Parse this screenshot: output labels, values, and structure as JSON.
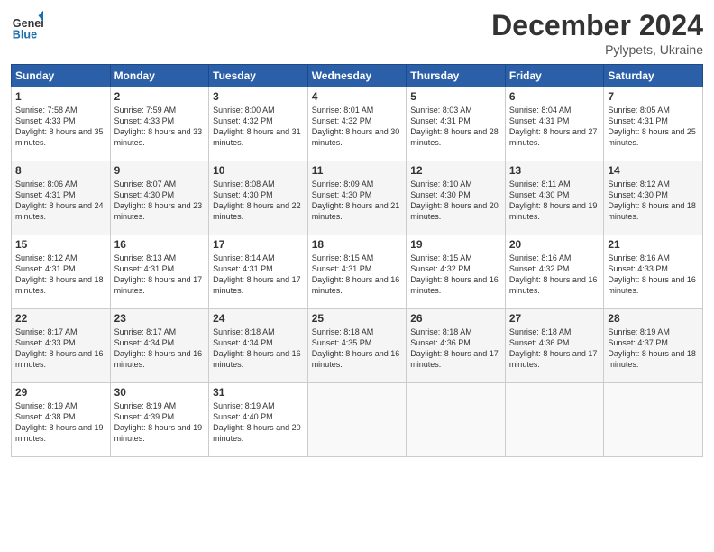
{
  "header": {
    "logo_general": "General",
    "logo_blue": "Blue",
    "month_year": "December 2024",
    "location": "Pylypets, Ukraine"
  },
  "days_of_week": [
    "Sunday",
    "Monday",
    "Tuesday",
    "Wednesday",
    "Thursday",
    "Friday",
    "Saturday"
  ],
  "weeks": [
    [
      {
        "day": "1",
        "sunrise": "Sunrise: 7:58 AM",
        "sunset": "Sunset: 4:33 PM",
        "daylight": "Daylight: 8 hours and 35 minutes."
      },
      {
        "day": "2",
        "sunrise": "Sunrise: 7:59 AM",
        "sunset": "Sunset: 4:33 PM",
        "daylight": "Daylight: 8 hours and 33 minutes."
      },
      {
        "day": "3",
        "sunrise": "Sunrise: 8:00 AM",
        "sunset": "Sunset: 4:32 PM",
        "daylight": "Daylight: 8 hours and 31 minutes."
      },
      {
        "day": "4",
        "sunrise": "Sunrise: 8:01 AM",
        "sunset": "Sunset: 4:32 PM",
        "daylight": "Daylight: 8 hours and 30 minutes."
      },
      {
        "day": "5",
        "sunrise": "Sunrise: 8:03 AM",
        "sunset": "Sunset: 4:31 PM",
        "daylight": "Daylight: 8 hours and 28 minutes."
      },
      {
        "day": "6",
        "sunrise": "Sunrise: 8:04 AM",
        "sunset": "Sunset: 4:31 PM",
        "daylight": "Daylight: 8 hours and 27 minutes."
      },
      {
        "day": "7",
        "sunrise": "Sunrise: 8:05 AM",
        "sunset": "Sunset: 4:31 PM",
        "daylight": "Daylight: 8 hours and 25 minutes."
      }
    ],
    [
      {
        "day": "8",
        "sunrise": "Sunrise: 8:06 AM",
        "sunset": "Sunset: 4:31 PM",
        "daylight": "Daylight: 8 hours and 24 minutes."
      },
      {
        "day": "9",
        "sunrise": "Sunrise: 8:07 AM",
        "sunset": "Sunset: 4:30 PM",
        "daylight": "Daylight: 8 hours and 23 minutes."
      },
      {
        "day": "10",
        "sunrise": "Sunrise: 8:08 AM",
        "sunset": "Sunset: 4:30 PM",
        "daylight": "Daylight: 8 hours and 22 minutes."
      },
      {
        "day": "11",
        "sunrise": "Sunrise: 8:09 AM",
        "sunset": "Sunset: 4:30 PM",
        "daylight": "Daylight: 8 hours and 21 minutes."
      },
      {
        "day": "12",
        "sunrise": "Sunrise: 8:10 AM",
        "sunset": "Sunset: 4:30 PM",
        "daylight": "Daylight: 8 hours and 20 minutes."
      },
      {
        "day": "13",
        "sunrise": "Sunrise: 8:11 AM",
        "sunset": "Sunset: 4:30 PM",
        "daylight": "Daylight: 8 hours and 19 minutes."
      },
      {
        "day": "14",
        "sunrise": "Sunrise: 8:12 AM",
        "sunset": "Sunset: 4:30 PM",
        "daylight": "Daylight: 8 hours and 18 minutes."
      }
    ],
    [
      {
        "day": "15",
        "sunrise": "Sunrise: 8:12 AM",
        "sunset": "Sunset: 4:31 PM",
        "daylight": "Daylight: 8 hours and 18 minutes."
      },
      {
        "day": "16",
        "sunrise": "Sunrise: 8:13 AM",
        "sunset": "Sunset: 4:31 PM",
        "daylight": "Daylight: 8 hours and 17 minutes."
      },
      {
        "day": "17",
        "sunrise": "Sunrise: 8:14 AM",
        "sunset": "Sunset: 4:31 PM",
        "daylight": "Daylight: 8 hours and 17 minutes."
      },
      {
        "day": "18",
        "sunrise": "Sunrise: 8:15 AM",
        "sunset": "Sunset: 4:31 PM",
        "daylight": "Daylight: 8 hours and 16 minutes."
      },
      {
        "day": "19",
        "sunrise": "Sunrise: 8:15 AM",
        "sunset": "Sunset: 4:32 PM",
        "daylight": "Daylight: 8 hours and 16 minutes."
      },
      {
        "day": "20",
        "sunrise": "Sunrise: 8:16 AM",
        "sunset": "Sunset: 4:32 PM",
        "daylight": "Daylight: 8 hours and 16 minutes."
      },
      {
        "day": "21",
        "sunrise": "Sunrise: 8:16 AM",
        "sunset": "Sunset: 4:33 PM",
        "daylight": "Daylight: 8 hours and 16 minutes."
      }
    ],
    [
      {
        "day": "22",
        "sunrise": "Sunrise: 8:17 AM",
        "sunset": "Sunset: 4:33 PM",
        "daylight": "Daylight: 8 hours and 16 minutes."
      },
      {
        "day": "23",
        "sunrise": "Sunrise: 8:17 AM",
        "sunset": "Sunset: 4:34 PM",
        "daylight": "Daylight: 8 hours and 16 minutes."
      },
      {
        "day": "24",
        "sunrise": "Sunrise: 8:18 AM",
        "sunset": "Sunset: 4:34 PM",
        "daylight": "Daylight: 8 hours and 16 minutes."
      },
      {
        "day": "25",
        "sunrise": "Sunrise: 8:18 AM",
        "sunset": "Sunset: 4:35 PM",
        "daylight": "Daylight: 8 hours and 16 minutes."
      },
      {
        "day": "26",
        "sunrise": "Sunrise: 8:18 AM",
        "sunset": "Sunset: 4:36 PM",
        "daylight": "Daylight: 8 hours and 17 minutes."
      },
      {
        "day": "27",
        "sunrise": "Sunrise: 8:18 AM",
        "sunset": "Sunset: 4:36 PM",
        "daylight": "Daylight: 8 hours and 17 minutes."
      },
      {
        "day": "28",
        "sunrise": "Sunrise: 8:19 AM",
        "sunset": "Sunset: 4:37 PM",
        "daylight": "Daylight: 8 hours and 18 minutes."
      }
    ],
    [
      {
        "day": "29",
        "sunrise": "Sunrise: 8:19 AM",
        "sunset": "Sunset: 4:38 PM",
        "daylight": "Daylight: 8 hours and 19 minutes."
      },
      {
        "day": "30",
        "sunrise": "Sunrise: 8:19 AM",
        "sunset": "Sunset: 4:39 PM",
        "daylight": "Daylight: 8 hours and 19 minutes."
      },
      {
        "day": "31",
        "sunrise": "Sunrise: 8:19 AM",
        "sunset": "Sunset: 4:40 PM",
        "daylight": "Daylight: 8 hours and 20 minutes."
      },
      null,
      null,
      null,
      null
    ]
  ]
}
